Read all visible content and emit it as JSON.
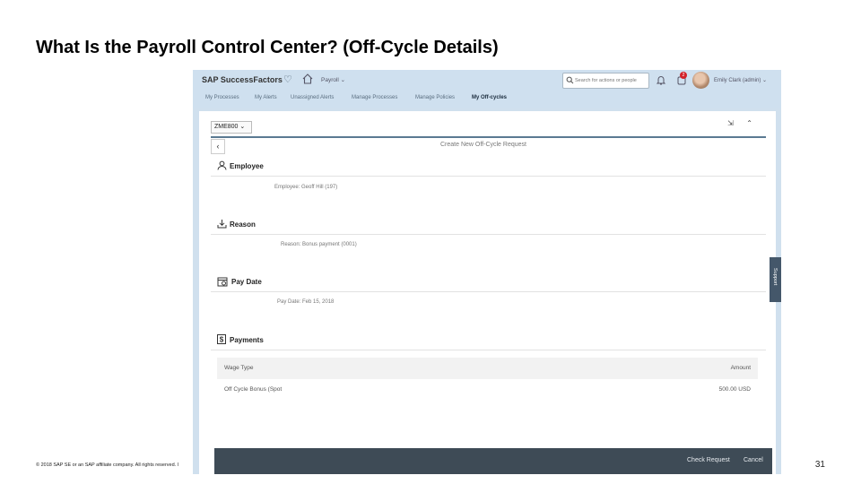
{
  "slide": {
    "title": "What Is the Payroll Control Center? (Off-Cycle Details)",
    "copyright": "© 2018 SAP SE or an SAP affiliate company. All rights reserved. ǀ",
    "page_number": "31"
  },
  "shell": {
    "logo": "SAP SuccessFactors",
    "module": "Payroll ⌄",
    "search_placeholder": "Search for actions or people",
    "notification_count": "2",
    "user": "Emily Clark (admin) ⌄"
  },
  "tabs": [
    {
      "label": "My Processes"
    },
    {
      "label": "My Alerts"
    },
    {
      "label": "Unassigned Alerts"
    },
    {
      "label": "Manage Processes"
    },
    {
      "label": "Manage Policies"
    },
    {
      "label": "My Off-cycles"
    }
  ],
  "panel": {
    "company_select": "ZME800 ⌄",
    "back": "‹",
    "form_title": "Create New Off-Cycle Request",
    "sections": {
      "employee": {
        "title": "Employee",
        "field": "Employee: Geoff Hill (197)"
      },
      "reason": {
        "title": "Reason",
        "field": "Reason: Bonus payment (0001)"
      },
      "pay_date": {
        "title": "Pay Date",
        "field": "Pay Date: Feb 15, 2018"
      },
      "payments": {
        "title": "Payments",
        "columns": [
          "Wage Type",
          "Amount"
        ],
        "rows": [
          [
            "Off Cycle Bonus (Spot",
            "500.00 USD"
          ]
        ]
      }
    },
    "footer": {
      "check": "Check Request",
      "cancel": "Cancel"
    },
    "side_tab": "Support"
  },
  "colors": {
    "shell": "#cfe0ef",
    "footer": "#3e4b56",
    "rule": "#5b7a92",
    "badge": "#d3222a"
  }
}
